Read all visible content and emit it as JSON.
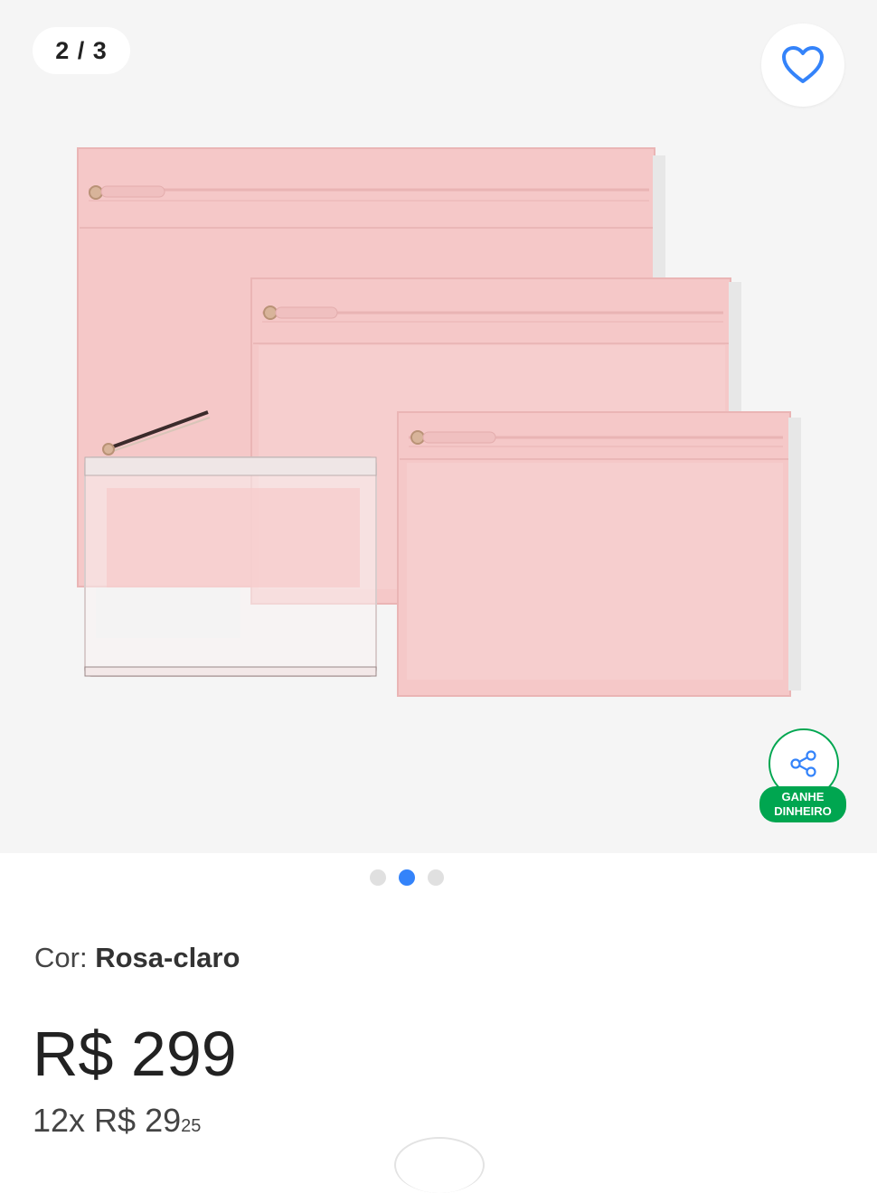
{
  "gallery": {
    "counter": "2 / 3",
    "favorite_icon": "heart-icon",
    "share_icon": "share-icon",
    "share_label_line1": "GANHE",
    "share_label_line2": "DINHEIRO",
    "dots_total": 3,
    "dots_active": 2
  },
  "product": {
    "color_label": "Cor:",
    "color_value": "Rosa-claro",
    "price": "R$ 299",
    "installments_prefix": "12x R$ 29",
    "installments_cents": "25"
  },
  "colors": {
    "accent": "#3483fa",
    "green": "#00a650",
    "pink": "#f2c8c8"
  }
}
